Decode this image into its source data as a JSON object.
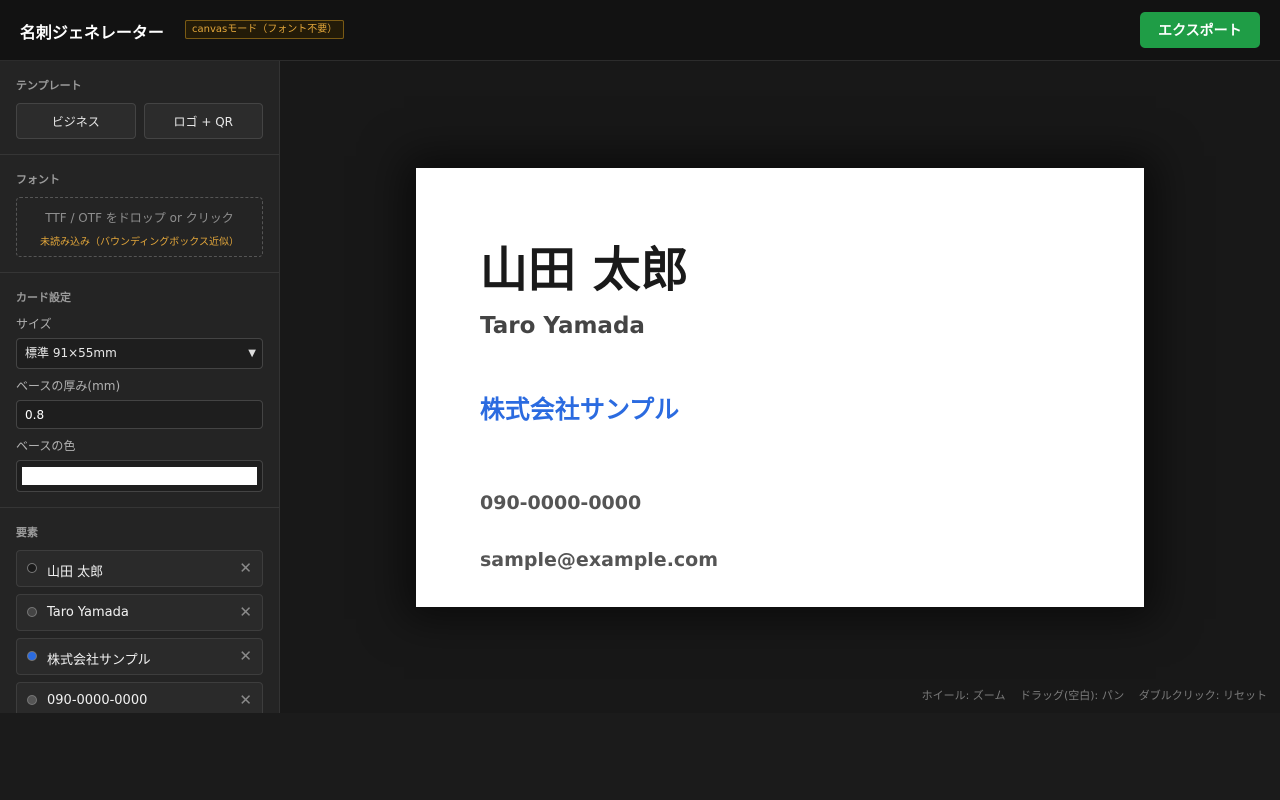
{
  "header": {
    "title": "名刺ジェネレーター",
    "mode_badge": "canvasモード（フォント不要）",
    "export_label": "エクスポート"
  },
  "sidebar": {
    "template": {
      "title": "テンプレート",
      "buttons": [
        "ビジネス",
        "ロゴ + QR"
      ]
    },
    "font": {
      "title": "フォント",
      "drop_label": "TTF / OTF をドロップ or クリック",
      "status": "未読み込み（バウンディングボックス近似）"
    },
    "card_settings": {
      "title": "カード設定",
      "size_label": "サイズ",
      "size_value": "標準 91×55mm",
      "thickness_label": "ベースの厚み(mm)",
      "thickness_value": "0.8",
      "color_label": "ベースの色",
      "color_value": "#ffffff"
    },
    "elements": {
      "title": "要素",
      "items": [
        {
          "label": "山田 太郎",
          "color": "#1a1a1a"
        },
        {
          "label": "Taro Yamada",
          "color": "#444444"
        },
        {
          "label": "株式会社サンプル",
          "color": "#2b6be0"
        },
        {
          "label": "090-0000-0000",
          "color": "#555555"
        }
      ]
    }
  },
  "card": {
    "name": "山田 太郎",
    "roman": "Taro Yamada",
    "company": "株式会社サンプル",
    "phone": "090-0000-0000",
    "email": "sample@example.com"
  },
  "hints": [
    "ホイール: ズーム",
    "ドラッグ(空白): パン",
    "ダブルクリック: リセット"
  ]
}
